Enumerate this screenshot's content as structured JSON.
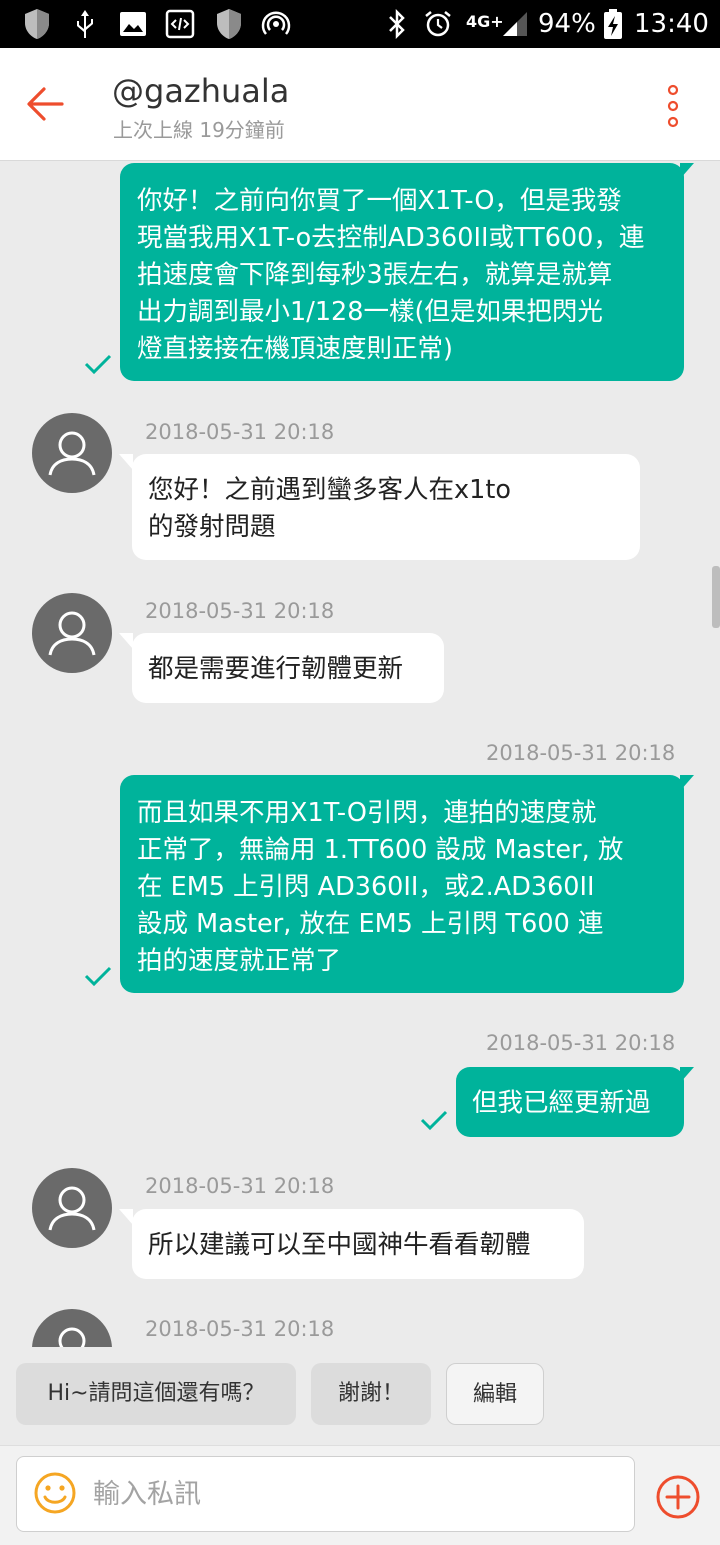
{
  "status_bar": {
    "signal_label": "4G+",
    "battery": "94%",
    "time": "13:40"
  },
  "header": {
    "title": "@gazhuala",
    "subtitle": "上次上線 19分鐘前"
  },
  "messages": [
    {
      "dir": "out",
      "text": "你好！之前向你買了一個X1T-O，但是我發\n現當我用X1T-o去控制AD360II或TT600，連\n拍速度會下降到每秒3張左右，就算是就算\n出力調到最小1/128一樣(但是如果把閃光\n燈直接接在機頂速度則正常)"
    },
    {
      "dir": "in",
      "time": "2018-05-31 20:18",
      "text": "您好！之前遇到蠻多客人在x1to\n的發射問題"
    },
    {
      "dir": "in",
      "time": "2018-05-31 20:18",
      "text": "都是需要進行韌體更新"
    },
    {
      "dir": "out",
      "time": "2018-05-31 20:18",
      "text": "而且如果不用X1T-O引閃，連拍的速度就\n正常了，無論用 1.TT600 設成 Master, 放\n在 EM5 上引閃 AD360II，或2.AD360II\n設成 Master, 放在 EM5 上引閃 T600 連\n拍的速度就正常了"
    },
    {
      "dir": "out",
      "time": "2018-05-31 20:18",
      "text": "但我已經更新過"
    },
    {
      "dir": "in",
      "time": "2018-05-31 20:18",
      "text": "所以建議可以至中國神牛看看韌體"
    },
    {
      "dir": "in",
      "time": "2018-05-31 20:18",
      "text": ""
    }
  ],
  "quick_replies": [
    "Hi~請問這個還有嗎？",
    "謝謝！",
    "編輯"
  ],
  "composer": {
    "placeholder": "輸入私訊"
  },
  "colors": {
    "accent": "#ee4d2d",
    "bubble_out": "#00b39b",
    "check": "#00b39b",
    "emoji": "#f5a623"
  },
  "icons": [
    "back-arrow-icon",
    "more-vertical-icon",
    "person-icon",
    "check-icon",
    "emoji-icon",
    "add-circle-icon"
  ]
}
